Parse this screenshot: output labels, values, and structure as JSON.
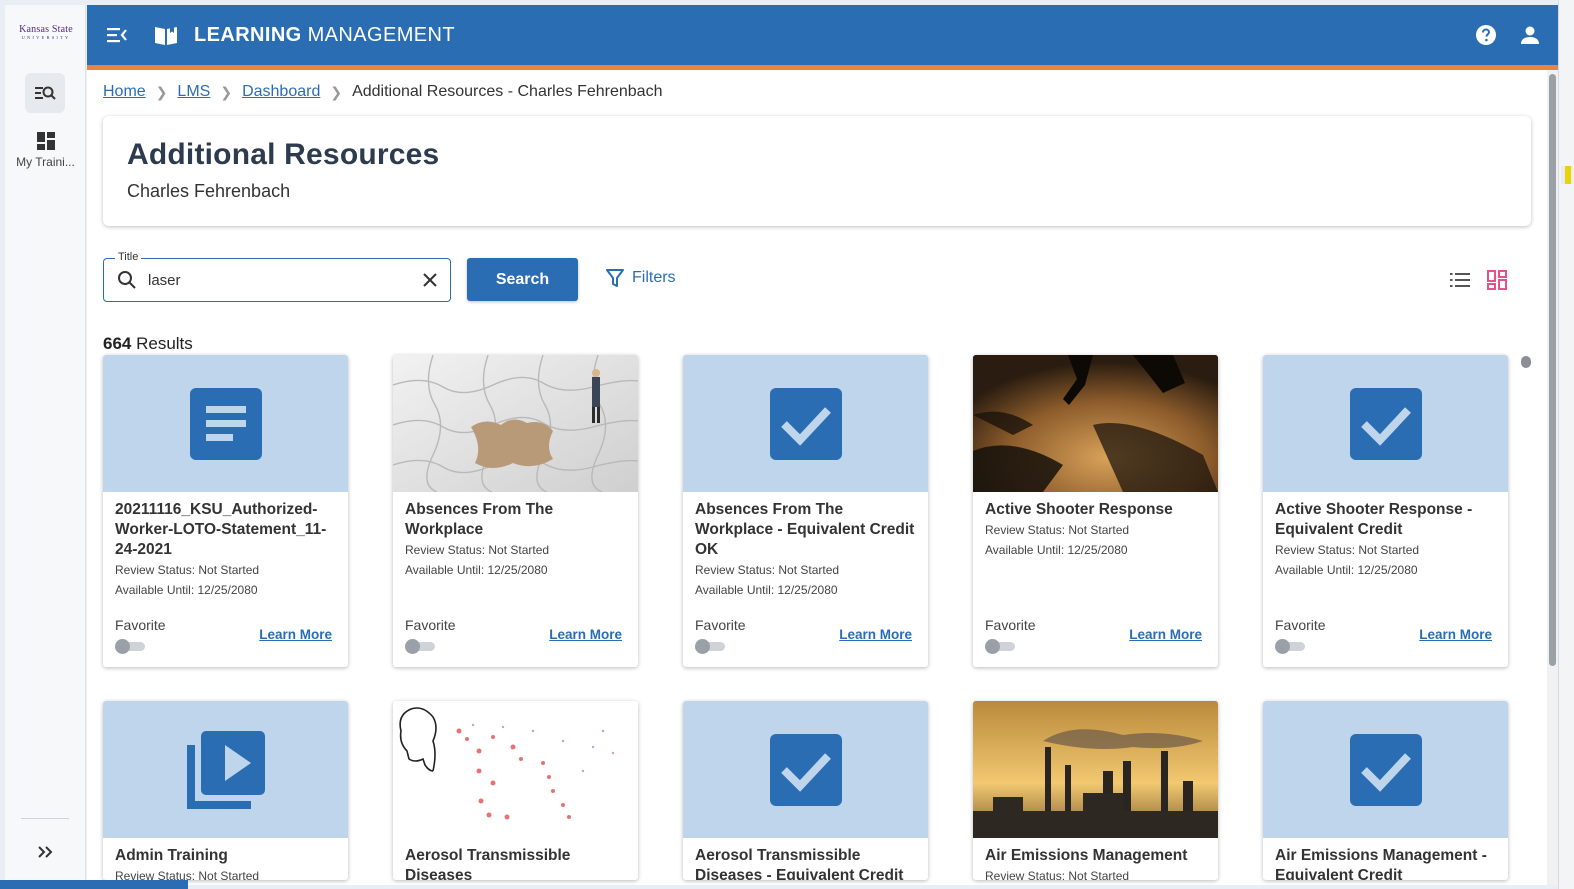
{
  "rail": {
    "logo_main": "Kansas State",
    "logo_sub": "UNIVERSITY",
    "my_training_label": "My Traini..."
  },
  "header": {
    "title_bold": "LEARNING",
    "title_rest": " MANAGEMENT"
  },
  "breadcrumb": {
    "items": [
      "Home",
      "LMS",
      "Dashboard"
    ],
    "current": "Additional Resources - Charles Fehrenbach"
  },
  "page": {
    "title": "Additional Resources",
    "subtitle": "Charles Fehrenbach"
  },
  "search": {
    "label": "Title",
    "value": "laser",
    "button": "Search",
    "filters": "Filters"
  },
  "results": {
    "count": "664",
    "label": " Results"
  },
  "colors": {
    "brand": "#2a6db3",
    "accent": "#f08040",
    "tile_bg": "#bed5ec"
  },
  "cards": [
    {
      "title": "20211116_KSU_Authorized-Worker-LOTO-Statement_11-24-2021",
      "status": "Review Status: Not Started",
      "available": "Available Until: 12/25/2080",
      "favorite": "Favorite",
      "learn_more": "Learn More",
      "icon": "document-icon"
    },
    {
      "title": "Absences From The Workplace",
      "status": "Review Status: Not Started",
      "available": "Available Until: 12/25/2080",
      "favorite": "Favorite",
      "learn_more": "Learn More",
      "icon": "puzzle-image"
    },
    {
      "title": "Absences From The Workplace - Equivalent Credit OK",
      "status": "Review Status: Not Started",
      "available": "Available Until: 12/25/2080",
      "favorite": "Favorite",
      "learn_more": "Learn More",
      "icon": "checkbox-icon"
    },
    {
      "title": "Active Shooter Response",
      "status": "Review Status: Not Started",
      "available": "Available Until: 12/25/2080",
      "favorite": "Favorite",
      "learn_more": "Learn More",
      "icon": "running-people-image"
    },
    {
      "title": "Active Shooter Response - Equivalent Credit",
      "status": "Review Status: Not Started",
      "available": "Available Until: 12/25/2080",
      "favorite": "Favorite",
      "learn_more": "Learn More",
      "icon": "checkbox-icon"
    },
    {
      "title": "Admin Training",
      "status": "Review Status: Not Started",
      "icon": "video-icon"
    },
    {
      "title": "Aerosol Transmissible Diseases",
      "icon": "aerosol-image"
    },
    {
      "title": "Aerosol Transmissible Diseases - Equivalent Credit",
      "icon": "checkbox-icon"
    },
    {
      "title": "Air Emissions Management",
      "status": "Review Status: Not Started",
      "icon": "factory-image"
    },
    {
      "title": "Air Emissions Management - Equivalent Credit",
      "icon": "checkbox-icon"
    }
  ]
}
